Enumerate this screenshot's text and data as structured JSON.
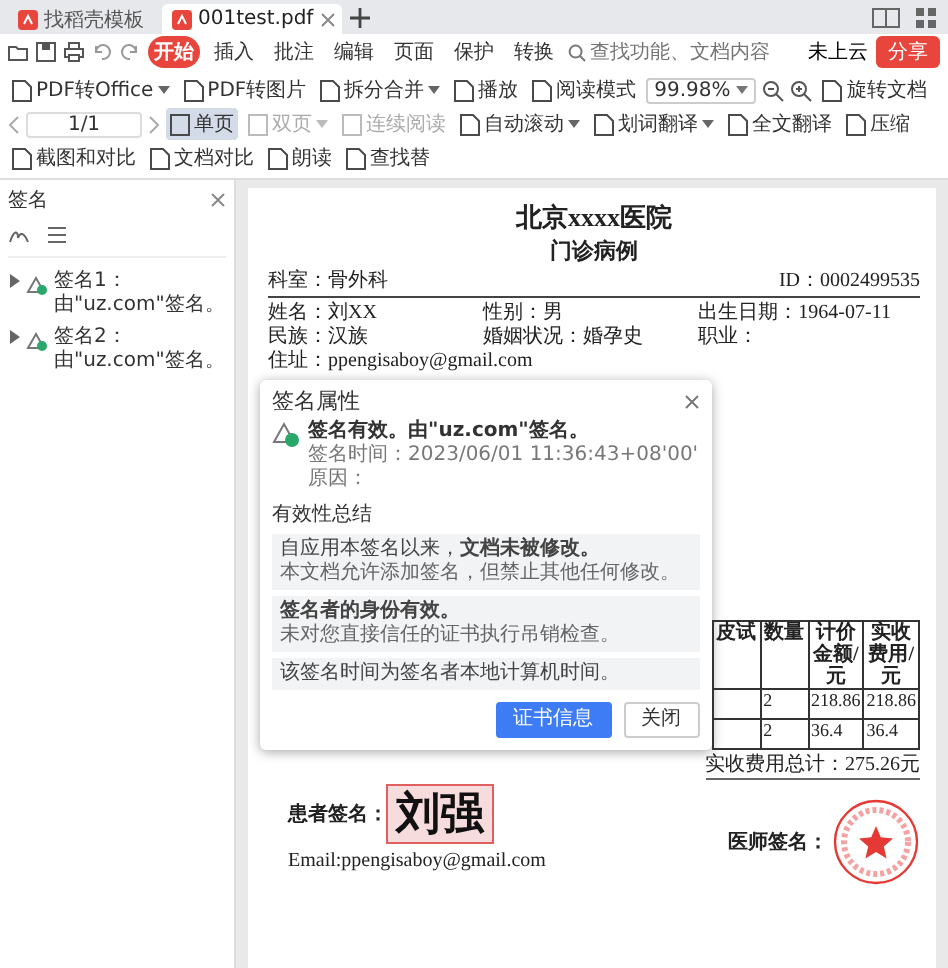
{
  "tabs": [
    {
      "label": "找稻壳模板",
      "selected": false
    },
    {
      "label": "001test.pdf",
      "selected": true
    }
  ],
  "menu": {
    "items": [
      {
        "label": "开始",
        "selected": true
      },
      {
        "label": "插入",
        "selected": false
      },
      {
        "label": "批注",
        "selected": false
      },
      {
        "label": "编辑",
        "selected": false
      },
      {
        "label": "页面",
        "selected": false
      },
      {
        "label": "保护",
        "selected": false
      },
      {
        "label": "转换",
        "selected": false
      }
    ],
    "search": {
      "placeholder": "查找功能、文档内容"
    },
    "cloud": "未上云",
    "share": "分享"
  },
  "toolbar": [
    {
      "kind": "button",
      "label": "PDF转Office",
      "dropdown": true
    },
    {
      "kind": "button",
      "label": "PDF转图片",
      "dropdown": false
    },
    {
      "kind": "button",
      "label": "拆分合并",
      "dropdown": true
    },
    {
      "kind": "button",
      "label": "播放",
      "dropdown": false
    },
    {
      "kind": "button",
      "label": "阅读模式",
      "dropdown": false
    },
    {
      "kind": "zoom",
      "label": "99.98%",
      "dropdown": true
    },
    {
      "kind": "button",
      "label": "旋转文档",
      "dropdown": false
    },
    {
      "kind": "pager",
      "label": "1/1"
    },
    {
      "kind": "view",
      "label": "单页",
      "dropdown": false,
      "selected": true,
      "disabled": false
    },
    {
      "kind": "view",
      "label": "双页",
      "dropdown": true,
      "selected": false,
      "disabled": true
    },
    {
      "kind": "view",
      "label": "连续阅读",
      "dropdown": false,
      "selected": false,
      "disabled": true
    },
    {
      "kind": "button",
      "label": "自动滚动",
      "dropdown": true
    },
    {
      "kind": "button",
      "label": "划词翻译",
      "dropdown": true
    },
    {
      "kind": "button",
      "label": "全文翻译",
      "dropdown": false
    },
    {
      "kind": "button",
      "label": "压缩",
      "dropdown": false
    },
    {
      "kind": "button",
      "label": "截图和对比",
      "dropdown": false
    },
    {
      "kind": "button",
      "label": "文档对比",
      "dropdown": false
    },
    {
      "kind": "button",
      "label": "朗读",
      "dropdown": false
    },
    {
      "kind": "button",
      "label": "查找替",
      "dropdown": false
    }
  ],
  "sidebar": {
    "title": "签名",
    "items": [
      {
        "label": "签名1：由\"uz.com\"签名。",
        "expanded": false
      },
      {
        "label": "签名2：由\"uz.com\"签名。",
        "expanded": false
      }
    ]
  },
  "document": {
    "hospital": "北京xxxx医院",
    "subtitle": "门诊病例",
    "department": "科室：骨外科",
    "id": "ID：0002499535",
    "fields": [
      [
        "姓名：刘XX",
        "性别：男",
        "出生日期：1964-07-11"
      ],
      [
        "民族：汉族",
        "婚姻状况：婚孕史",
        "职业："
      ],
      [
        "住址：ppengisaboy@gmail.com"
      ]
    ],
    "table": {
      "columns": [
        "皮试",
        "数量",
        "计价金额/元",
        "实收费用/元"
      ],
      "rows": [
        {
          "cells": [
            "",
            "2",
            "218.86",
            "218.86"
          ]
        },
        {
          "cells": [
            "",
            "2",
            "36.4",
            "36.4"
          ]
        }
      ]
    },
    "total": "实收费用总计：275.26元",
    "patient_label": "患者签名：",
    "signature": "刘强",
    "email": "Email:ppengisaboy@gmail.com",
    "doctor_label": "医师签名："
  },
  "dialog": {
    "title": "签名属性",
    "status": "签名有效。由\"uz.com\"签名。",
    "time": "签名时间：2023/06/01 11:36:43+08'00'",
    "reason": "原因：",
    "section": "有效性总结",
    "notes": [
      {
        "lines": [
          "自应用本签名以来，**文档未被修改。**",
          "本文档允许添加签名，但禁止其他任何修改。"
        ]
      },
      {
        "lines": [
          "**签名者的身份有效。**",
          "未对您直接信任的证书执行吊销检查。"
        ]
      },
      {
        "lines": [
          "该签名时间为签名者本地计算机时间。"
        ]
      }
    ],
    "buttons": [
      {
        "label": "证书信息",
        "primary": true
      },
      {
        "label": "关闭",
        "primary": false
      }
    ]
  }
}
